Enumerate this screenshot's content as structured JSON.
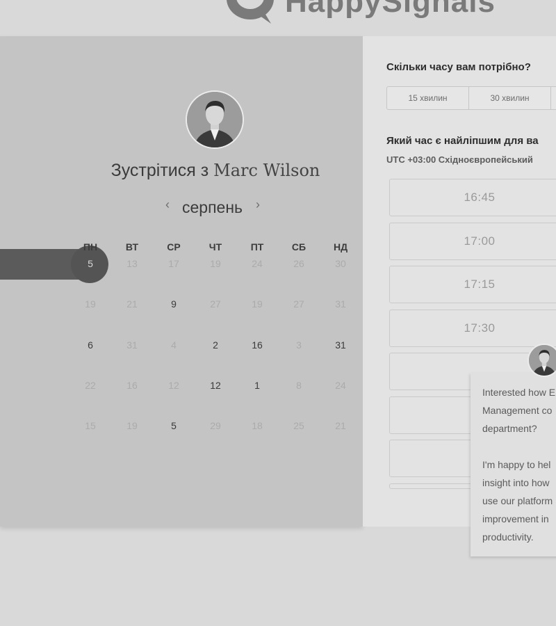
{
  "header": {
    "logo_text": "HappySignals"
  },
  "calendar": {
    "title_prefix": "Зустрітися з ",
    "host_name": "Marc Wilson",
    "month": "серпень",
    "prev_icon": "‹",
    "next_icon": "›",
    "weekdays": [
      "ПН",
      "ВТ",
      "СР",
      "ЧТ",
      "ПТ",
      "СБ",
      "НД"
    ],
    "weeks": [
      [
        "5",
        "13",
        "17",
        "19",
        "24",
        "26",
        "30"
      ],
      [
        "19",
        "21",
        "9",
        "27",
        "19",
        "27",
        "31"
      ],
      [
        "6",
        "31",
        "4",
        "2",
        "16",
        "3",
        "31"
      ],
      [
        "22",
        "16",
        "12",
        "12",
        "1",
        "8",
        "24"
      ],
      [
        "15",
        "19",
        "5",
        "29",
        "18",
        "25",
        "21"
      ]
    ],
    "available": [
      [
        0,
        0
      ],
      [
        1,
        2
      ],
      [
        2,
        0
      ],
      [
        2,
        3
      ],
      [
        2,
        4
      ],
      [
        2,
        6
      ],
      [
        3,
        3
      ],
      [
        3,
        4
      ],
      [
        4,
        2
      ]
    ],
    "selected": [
      0,
      0
    ]
  },
  "time_panel": {
    "duration_heading": "Скільки часу вам потрібно?",
    "durations": [
      "15 хвилин",
      "30 хвилин",
      ""
    ],
    "time_heading": "Який час є найліпшим для ва",
    "timezone": "UTC +03:00 Східноєвропейський",
    "slots": [
      "16:45",
      "17:00",
      "17:15",
      "17:30",
      "",
      "",
      "",
      ""
    ]
  },
  "chat": {
    "lines": [
      "Interested how E",
      "Management co",
      "department?",
      "",
      "I'm happy to hel",
      "insight into how",
      "use our platform",
      "improvement in",
      "productivity."
    ]
  },
  "colors": {
    "background": "#d9d9d9",
    "calendar_panel": "#c4c4c4",
    "time_panel": "#e3e3e3",
    "selected_day": "#545454"
  }
}
